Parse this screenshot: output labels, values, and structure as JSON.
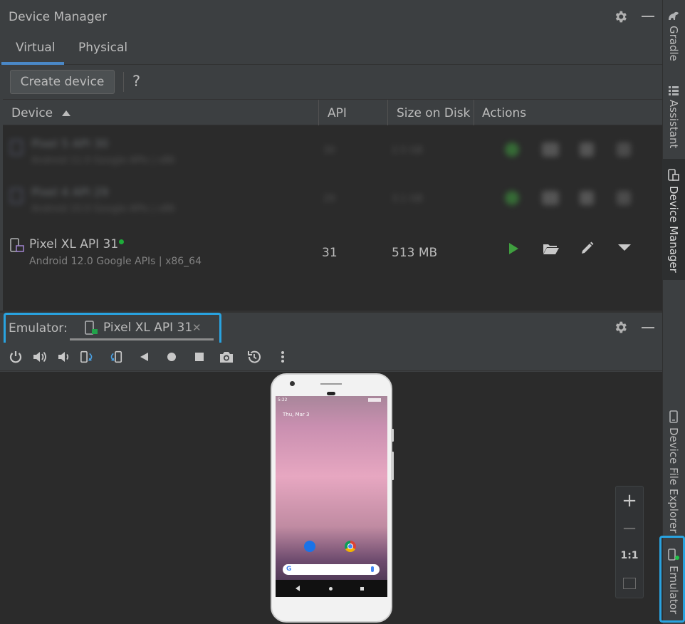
{
  "device_manager": {
    "title": "Device Manager",
    "tabs": [
      {
        "label": "Virtual",
        "selected": true
      },
      {
        "label": "Physical",
        "selected": false
      }
    ],
    "create_device_label": "Create device",
    "help_label": "?",
    "columns": {
      "device": "Device",
      "api": "API",
      "size": "Size on Disk",
      "actions": "Actions"
    },
    "blurred_rows": [
      {
        "name": "Pixel 5 API 30",
        "sub": "Android 11.0 Google APIs | x86",
        "api": "30",
        "size": "2.5 GB"
      },
      {
        "name": "Pixel 4 API 29",
        "sub": "Android 10.0 Google APIs | x86",
        "api": "29",
        "size": "3.1 GB"
      }
    ],
    "row": {
      "name": "Pixel XL API 31",
      "status_color": "#1eac3a",
      "subtitle": "Android 12.0 Google APIs | x86_64",
      "api": "31",
      "size": "513 MB"
    }
  },
  "emulator": {
    "label": "Emulator:",
    "tab_label": "Pixel XL API 31",
    "close_glyph": "✕",
    "toolbar": [
      "power-icon",
      "volume-up-icon",
      "volume-down-icon",
      "rotate-left-icon",
      "rotate-right-icon",
      "back-icon",
      "home-icon",
      "overview-icon",
      "screenshot-icon",
      "snapshot-icon",
      "more-icon"
    ],
    "phone": {
      "status_time": "5:22",
      "date_text": "Thu, Mar 3"
    },
    "zoom": {
      "plus": "+",
      "minus": "−",
      "one_to_one": "1:1"
    }
  },
  "right_stripe": {
    "gradle": "Gradle",
    "assistant": "Assistant",
    "device_manager": "Device Manager",
    "device_file_explorer": "Device File Explorer",
    "emulator": "Emulator"
  },
  "colors": {
    "accent": "#4a88c7",
    "highlight": "#29a3e0",
    "play": "#3f9f3f"
  }
}
